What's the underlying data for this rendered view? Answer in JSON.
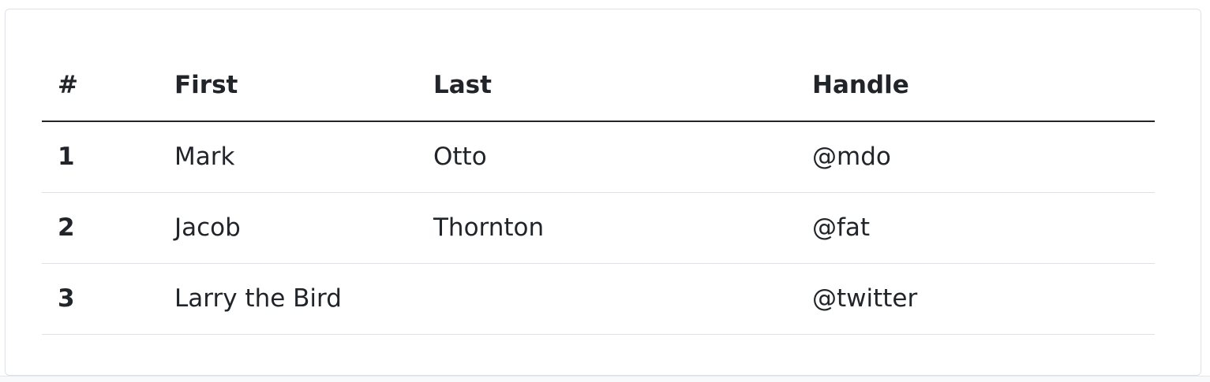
{
  "table": {
    "headers": [
      "#",
      "First",
      "Last",
      "Handle"
    ],
    "rows": [
      [
        "1",
        "Mark",
        "Otto",
        "@mdo"
      ],
      [
        "2",
        "Jacob",
        "Thornton",
        "@fat"
      ],
      [
        "3",
        "Larry the Bird",
        "",
        "@twitter"
      ]
    ]
  }
}
